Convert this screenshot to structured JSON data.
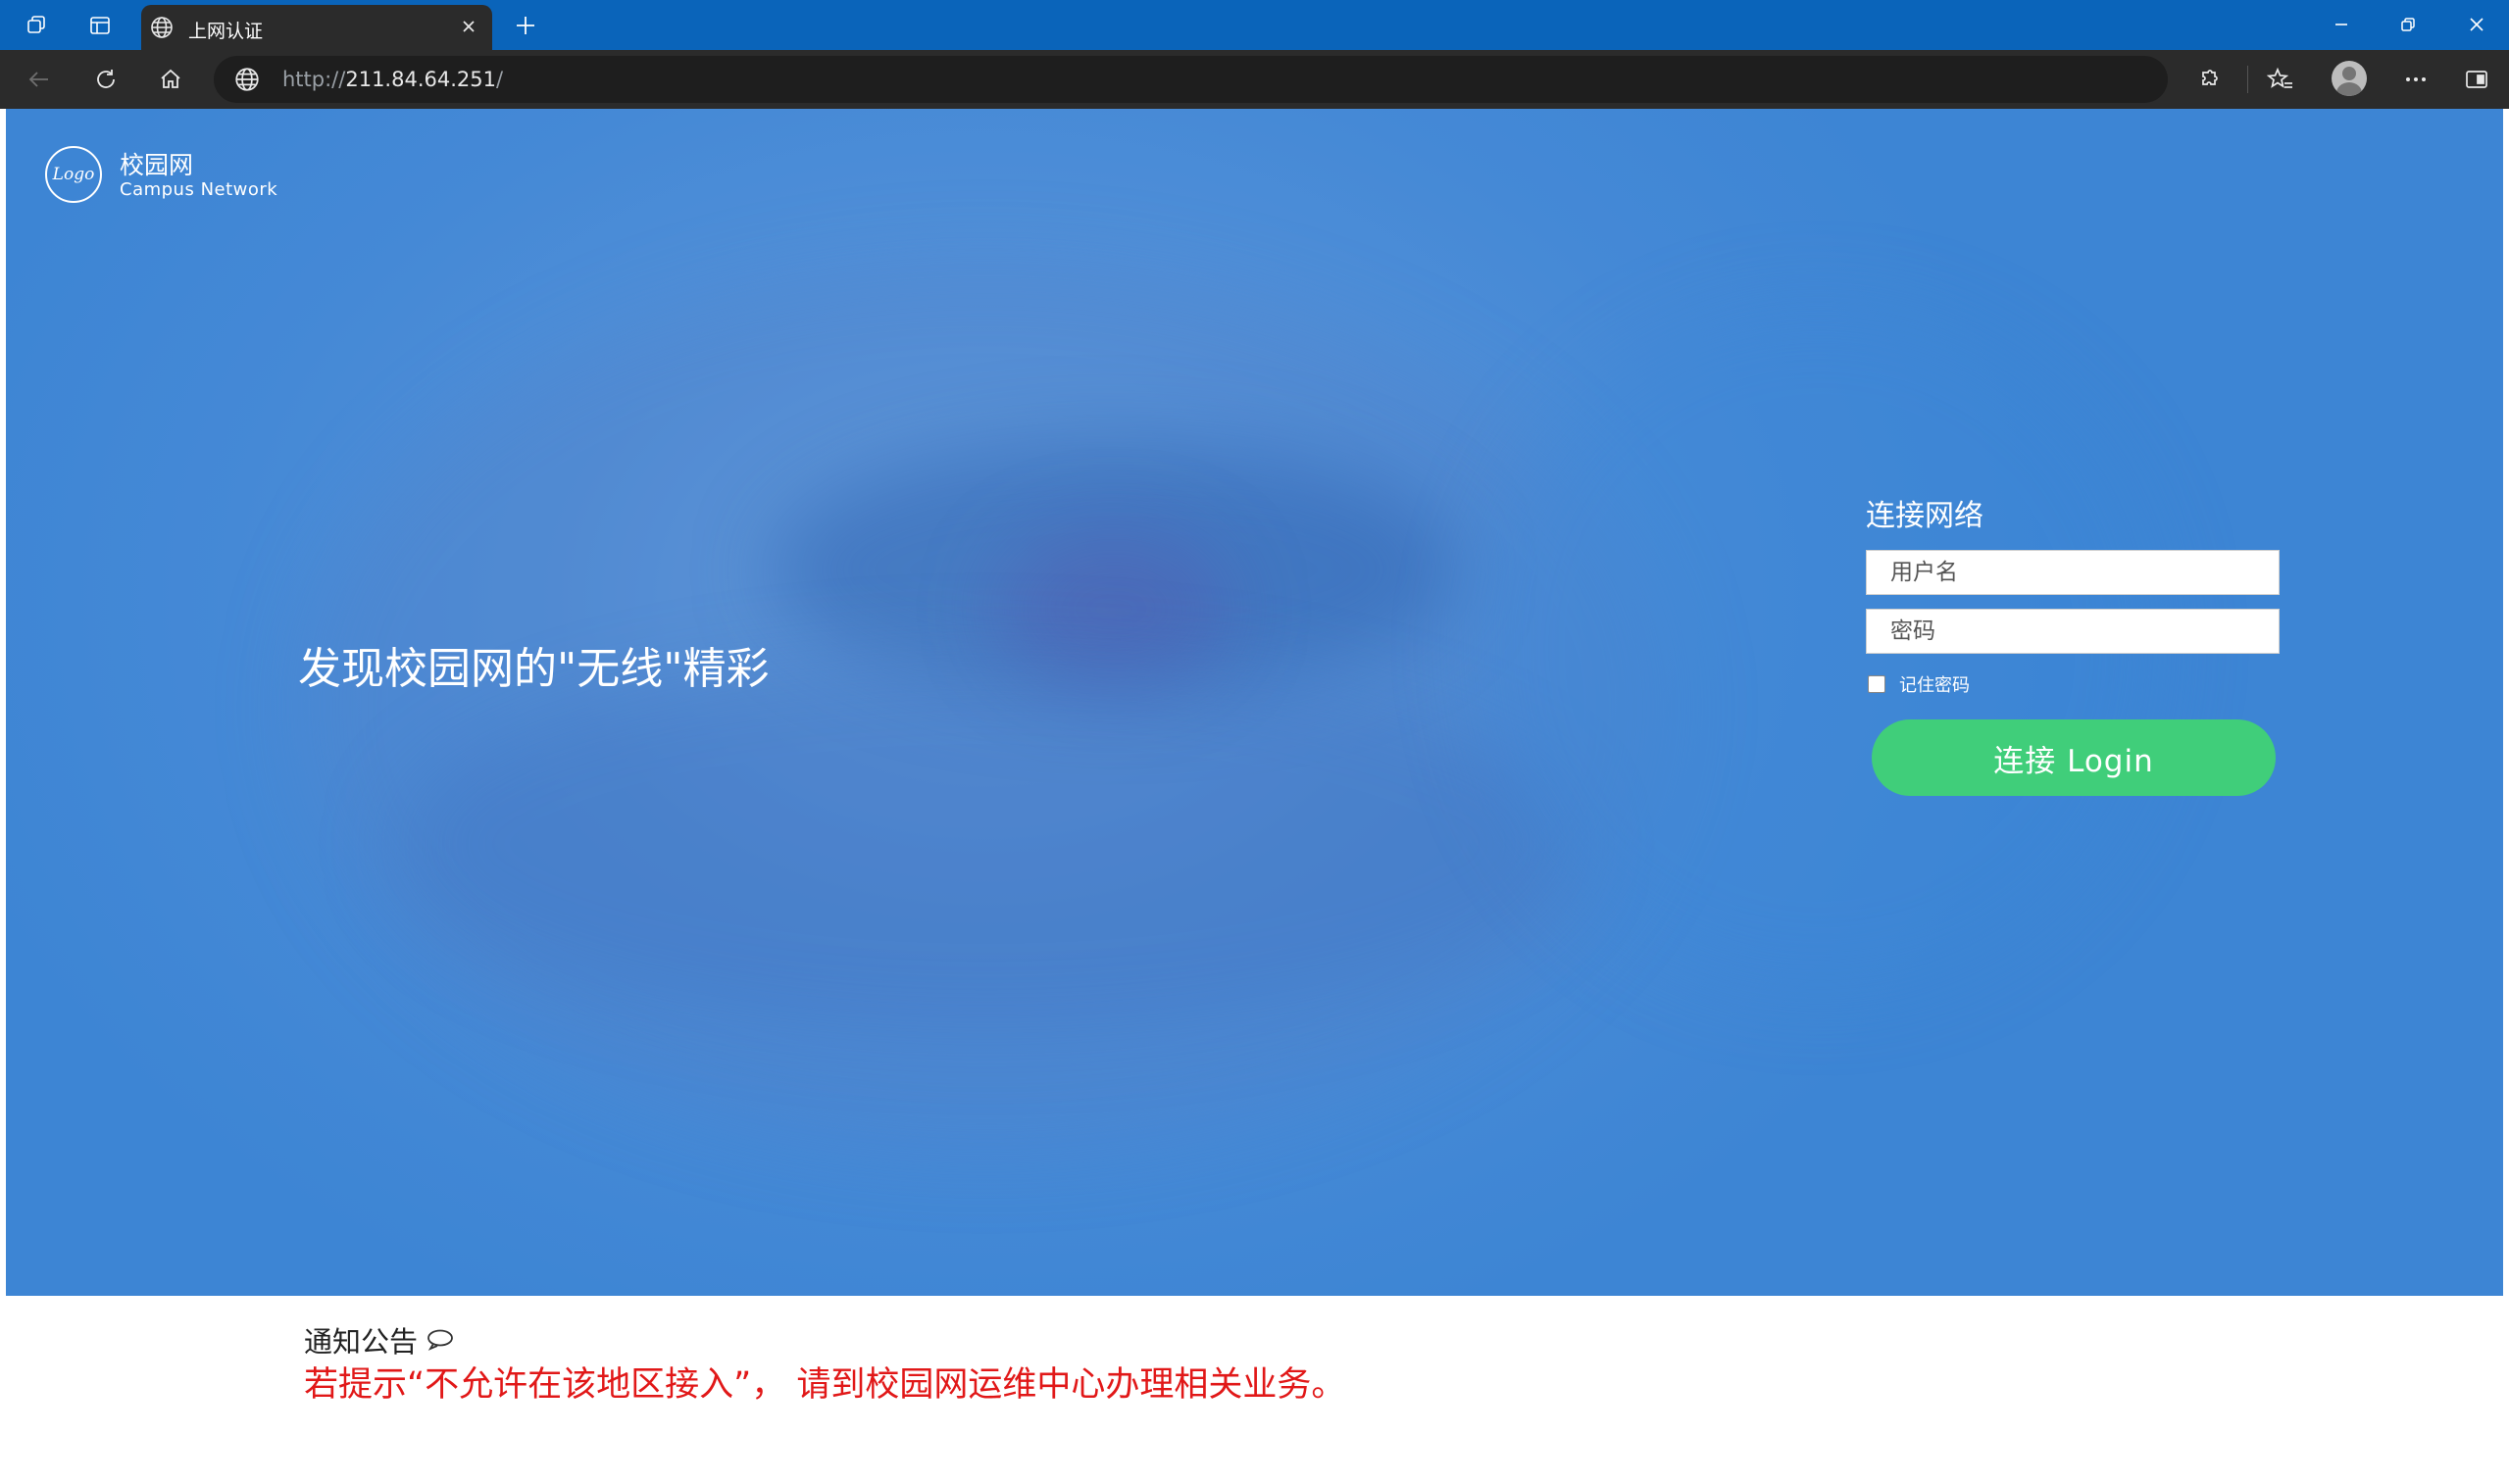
{
  "browser": {
    "tab_title": "上网认证",
    "url_prefix": "http://",
    "url_host": "211.84.64.251",
    "url_suffix": "/"
  },
  "icons": {
    "workspaces": "workspaces-icon",
    "tab_actions": "tab-actions-icon",
    "globe": "globe-icon",
    "close": "close-icon",
    "new_tab": "plus-icon",
    "minimize": "minimize-icon",
    "restore": "restore-icon",
    "window_close": "window-close-icon",
    "back": "back-arrow-icon",
    "refresh": "refresh-icon",
    "home": "home-icon",
    "extensions": "puzzle-icon",
    "favorites": "favorites-icon",
    "profile": "profile-avatar",
    "more": "more-icon",
    "sidebar": "split-screen-icon",
    "notice": "speech-bubble-icon"
  },
  "colors": {
    "titlebar": "#0a64ba",
    "toolbar": "#2b2b2b",
    "hero_blue": "#4589d6",
    "login_button": "#40ce7a",
    "notice_red": "#e11818"
  },
  "page": {
    "logo": {
      "mark": "Logo",
      "name": "校园网",
      "subtitle": "Campus  Network"
    },
    "slogan": "发现校园网的\"无线\"精彩",
    "login": {
      "title": "连接网络",
      "username_placeholder": "用户名",
      "username_value": "",
      "password_placeholder": "密码",
      "password_value": "",
      "remember_label": "记住密码",
      "remember_checked": false,
      "button_label": "连接 Login"
    },
    "notice": {
      "title": "通知公告",
      "text": "若提示“不允许在该地区接入”，  请到校园网运维中心办理相关业务。"
    }
  }
}
